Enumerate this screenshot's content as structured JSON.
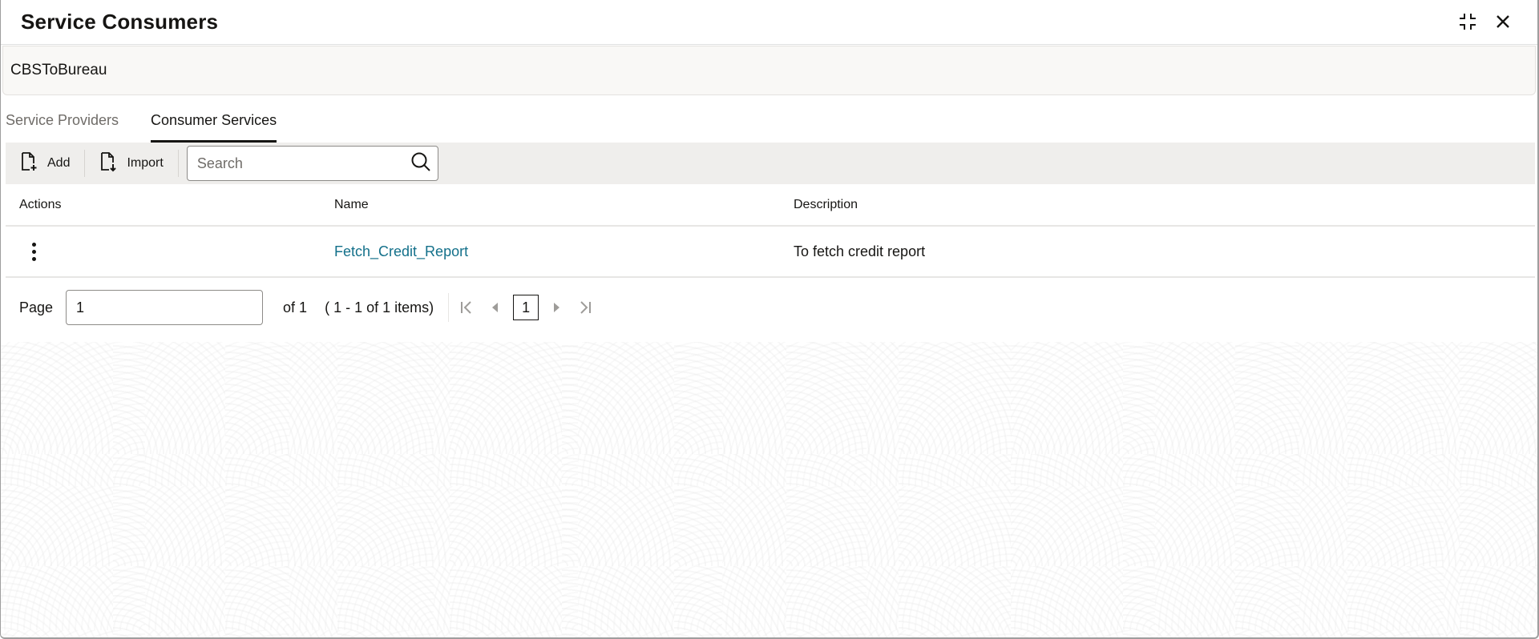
{
  "header": {
    "title": "Service Consumers",
    "icons": [
      "collapse-icon",
      "close-icon"
    ]
  },
  "context": {
    "name": "CBSToBureau"
  },
  "tabs": [
    {
      "label": "Service Providers",
      "active": false
    },
    {
      "label": "Consumer Services",
      "active": true
    }
  ],
  "toolbar": {
    "add_label": "Add",
    "import_label": "Import",
    "search_placeholder": "Search",
    "search_value": ""
  },
  "table": {
    "columns": [
      "Actions",
      "Name",
      "Description"
    ],
    "rows": [
      {
        "name": "Fetch_Credit_Report",
        "description": "To fetch credit report"
      }
    ]
  },
  "pagination": {
    "page_label": "Page",
    "page_value": "1",
    "of_label": "of 1",
    "range_label": "( 1 - 1 of 1 items)",
    "current_page": "1"
  },
  "colors": {
    "link": "#13708a",
    "toolbar_bg": "#efeeec",
    "context_bg": "#f9f8f6",
    "text": "#161513"
  }
}
